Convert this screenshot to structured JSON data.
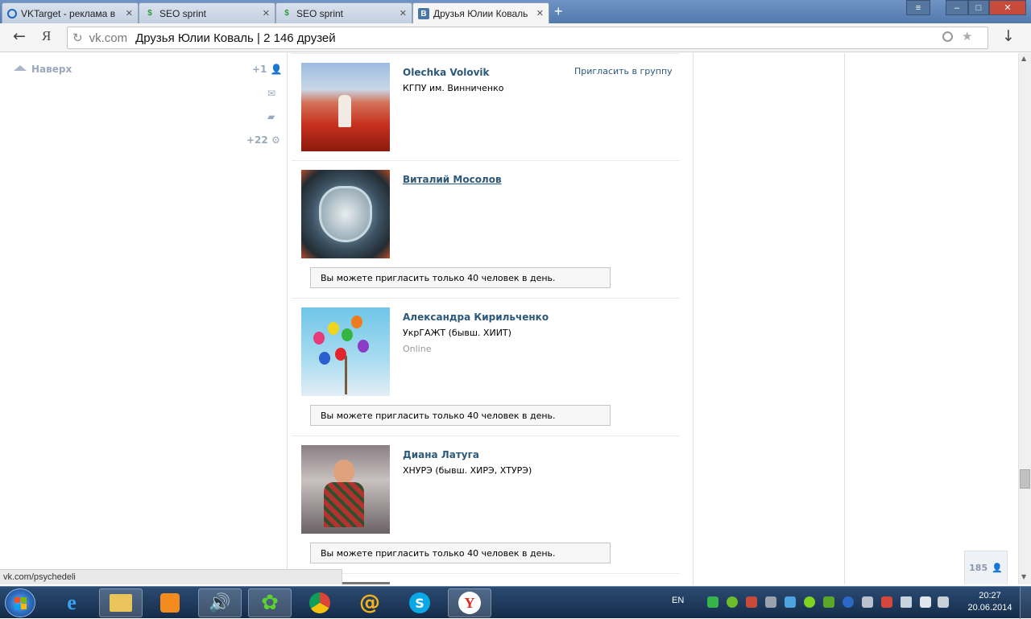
{
  "tabs": [
    {
      "title": "VKTarget - реклама в",
      "icon": "target-icon",
      "active": false
    },
    {
      "title": "SEO sprint",
      "icon": "seosprint-icon",
      "active": false
    },
    {
      "title": "SEO sprint",
      "icon": "seosprint-icon",
      "active": false
    },
    {
      "title": "Друзья Юлии Коваль",
      "icon": "vk-icon",
      "icon_text": "B",
      "active": true
    }
  ],
  "window": {
    "minimize": "–",
    "maximize": "□",
    "close": "✕",
    "menu": "≡",
    "new_tab": "+"
  },
  "toolbar": {
    "back": "←",
    "yandex": "Я",
    "reload": "↻",
    "download": "↓"
  },
  "address": {
    "domain": "vk.com",
    "page_title": "Друзья Юлии Коваль | 2 146 друзей"
  },
  "sidebar": {
    "up_label": "Наверх",
    "friends_count": "+1",
    "notifications_count": "+22"
  },
  "friends": [
    {
      "name": "Olechka Volovik",
      "sub": "КГПУ им. Винниченко",
      "extra": "",
      "action": "Пригласить в группу",
      "warning": ""
    },
    {
      "name": "Виталий Мосолов",
      "sub": "",
      "extra": "",
      "action": "",
      "warning": "Вы можете пригласить только 40 человек в день."
    },
    {
      "name": "Александра Кирильченко",
      "sub": "УкрГАЖТ (бывш. ХИИТ)",
      "extra": "Online",
      "action": "",
      "warning": "Вы можете пригласить только 40 человек в день."
    },
    {
      "name": "Диана Латуга",
      "sub": "ХНУРЭ (бывш. ХИРЭ, ХТУРЭ)",
      "extra": "",
      "action": "",
      "warning": "Вы можете пригласить только 40 человек в день."
    }
  ],
  "online_badge": "185",
  "status_url": "vk.com/psychedeli",
  "taskbar": {
    "lang": "EN",
    "time": "20:27",
    "date": "20.06.2014"
  },
  "colors": {
    "vk_link": "#2b587a",
    "online": "#999999"
  }
}
